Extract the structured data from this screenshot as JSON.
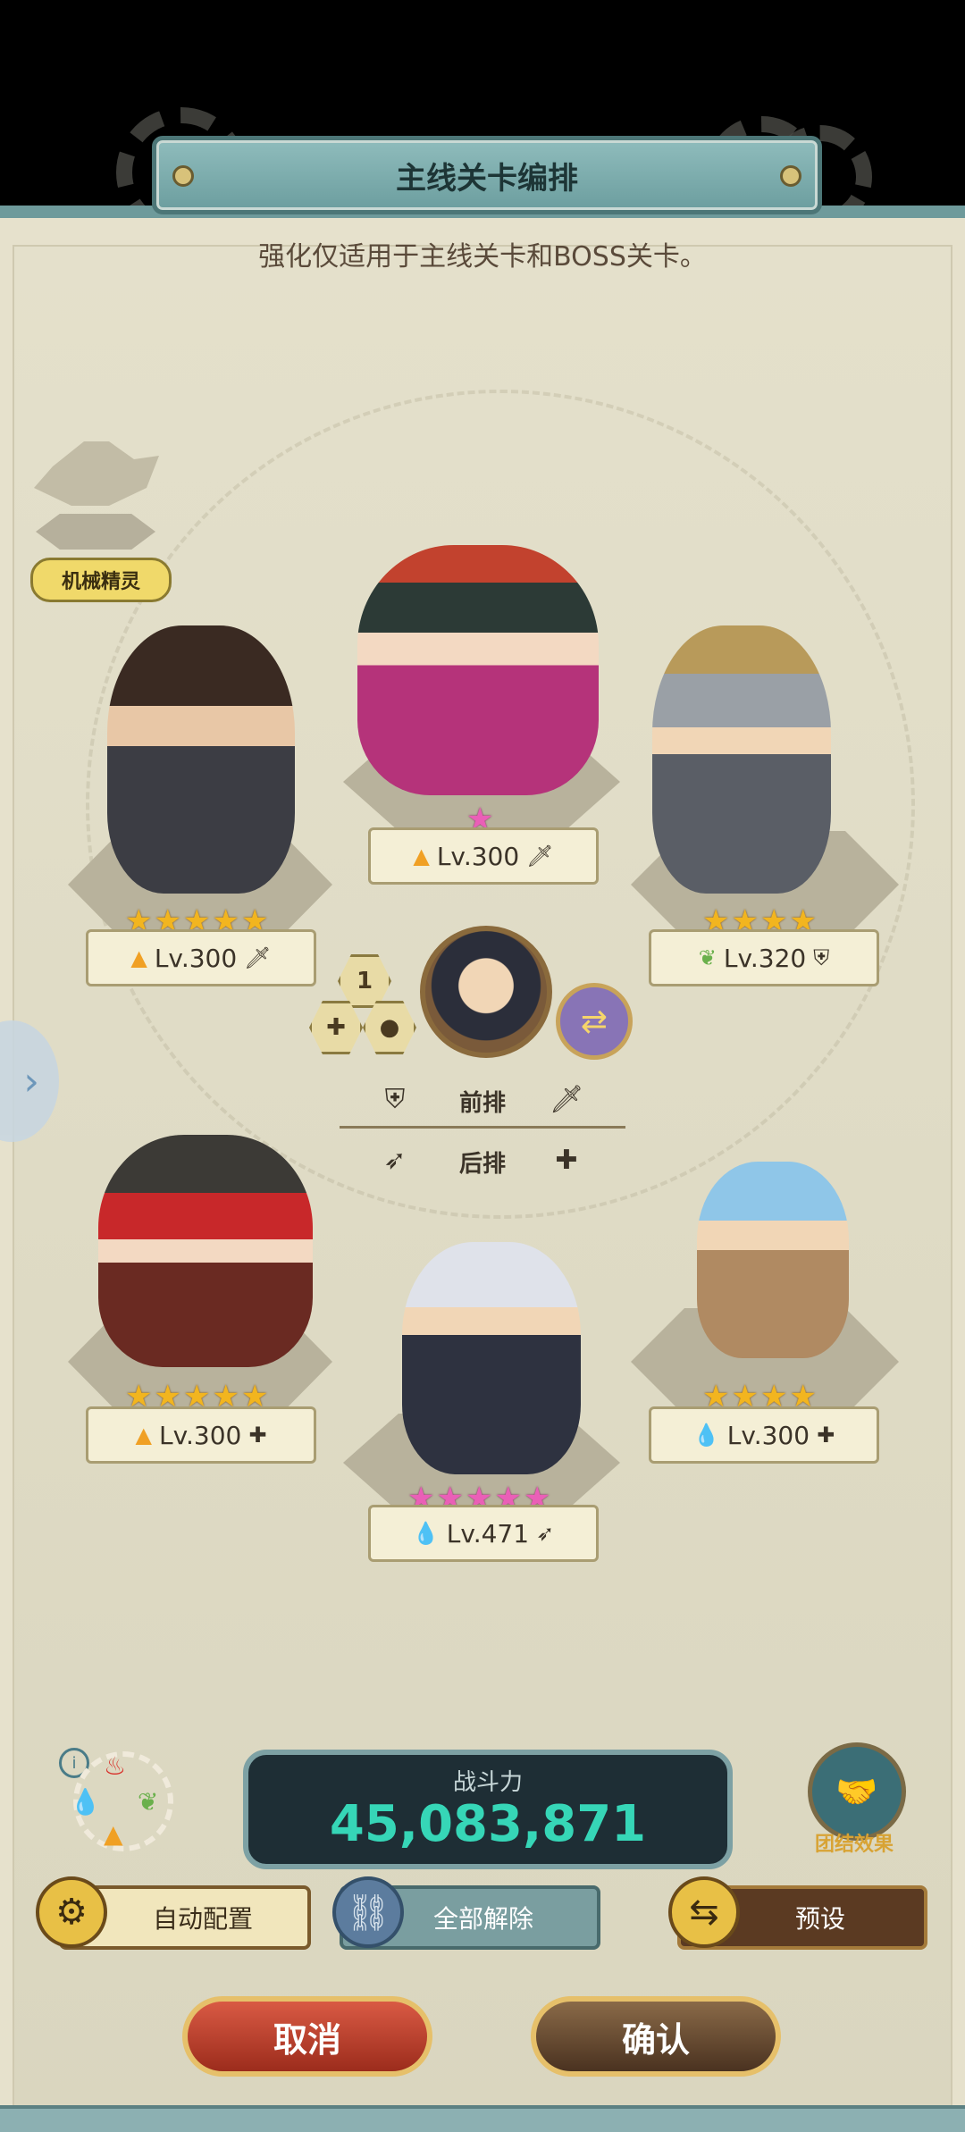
{
  "header": {
    "title": "主线关卡编排",
    "subtitle": "强化仅适用于主线关卡和BOSS关卡。"
  },
  "pet": {
    "label": "机械精灵"
  },
  "heroes": [
    {
      "slot": "front-left",
      "stars": 5,
      "star_color": "gold",
      "element": "fire",
      "level": "Lv.300",
      "role": "tank"
    },
    {
      "slot": "front-center",
      "stars": 1,
      "star_color": "pink",
      "element": "fire",
      "level": "Lv.300",
      "role": "tank"
    },
    {
      "slot": "front-right",
      "stars": 4,
      "star_color": "gold",
      "element": "nature",
      "level": "Lv.320",
      "role": "shield"
    },
    {
      "slot": "back-left",
      "stars": 5,
      "star_color": "gold",
      "element": "fire",
      "level": "Lv.300",
      "role": "healer"
    },
    {
      "slot": "back-center",
      "stars": 5,
      "star_color": "pink",
      "element": "water",
      "level": "Lv.471",
      "role": "ranged"
    },
    {
      "slot": "back-right",
      "stars": 4,
      "star_color": "gold",
      "element": "water",
      "level": "Lv.300",
      "role": "healer"
    }
  ],
  "leader": {
    "slot_number": "1"
  },
  "rows": {
    "front": "前排",
    "back": "后排"
  },
  "power": {
    "label": "战斗力",
    "value": "45,083,871"
  },
  "unity": {
    "label": "团结效果"
  },
  "buttons": {
    "auto": "自动配置",
    "clear": "全部解除",
    "preset": "预设",
    "cancel": "取消",
    "confirm": "确认"
  },
  "colors": {
    "accent_teal": "#6c9e9f",
    "power_text": "#36d6b7",
    "cancel": "#c2432f",
    "confirm": "#5e4128"
  },
  "icons": [
    "gear-icon",
    "fire-icon",
    "water-icon",
    "nature-icon",
    "sword-icon",
    "shield-icon",
    "cross-icon",
    "bow-icon",
    "swap-icon",
    "chevron-right-icon",
    "info-icon",
    "handshake-icon",
    "chain-icon"
  ]
}
